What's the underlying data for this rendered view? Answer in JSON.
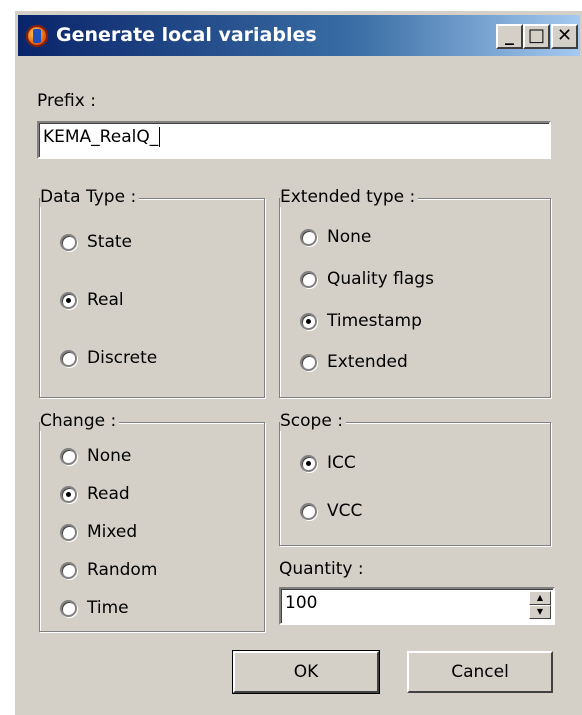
{
  "window": {
    "title": "Generate local variables",
    "minimize": "_",
    "maximize": "□",
    "close": "✕"
  },
  "prefix": {
    "label": "Prefix :",
    "value": "KEMA_RealQ_"
  },
  "data_type": {
    "label": "Data Type :",
    "options": [
      {
        "label": "State",
        "checked": false
      },
      {
        "label": "Real",
        "checked": true
      },
      {
        "label": "Discrete",
        "checked": false
      }
    ]
  },
  "extended_type": {
    "label": "Extended type :",
    "options": [
      {
        "label": "None",
        "checked": false
      },
      {
        "label": "Quality flags",
        "checked": false
      },
      {
        "label": "Timestamp",
        "checked": true
      },
      {
        "label": "Extended",
        "checked": false
      }
    ]
  },
  "change": {
    "label": "Change :",
    "options": [
      {
        "label": "None",
        "checked": false
      },
      {
        "label": "Read",
        "checked": true
      },
      {
        "label": "Mixed",
        "checked": false
      },
      {
        "label": "Random",
        "checked": false
      },
      {
        "label": "Time",
        "checked": false
      }
    ]
  },
  "scope": {
    "label": "Scope :",
    "options": [
      {
        "label": "ICC",
        "checked": true
      },
      {
        "label": "VCC",
        "checked": false
      }
    ]
  },
  "quantity": {
    "label": "Quantity :",
    "value": "100"
  },
  "buttons": {
    "ok": "OK",
    "cancel": "Cancel"
  }
}
